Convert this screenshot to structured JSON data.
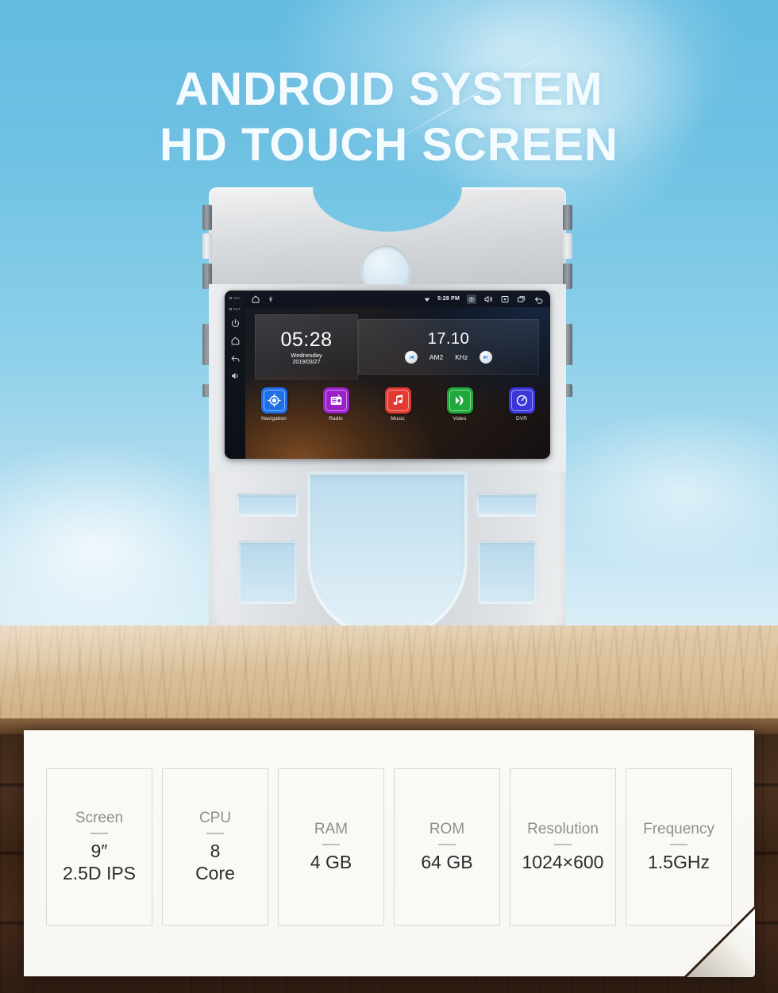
{
  "headline": {
    "line1": "ANDROID SYSTEM",
    "line2": "HD TOUCH SCREEN"
  },
  "colors": {
    "sky_top": "#63bbe1",
    "sky_bottom": "#dcf0f8",
    "headline_text": "#f4fbfe",
    "table_wood": "#dcc49f",
    "floor_wood": "#3b2415",
    "sheet_bg": "#faf9f6",
    "card_border": "#d8d8d4",
    "nav_icon": "#1f6fe8",
    "radio_icon": "#9b20c9",
    "music_icon": "#e23a32",
    "video_icon": "#1fa83c",
    "dvr_icon": "#3a36d8"
  },
  "device": {
    "side_buttons": [
      {
        "name": "mic-indicator",
        "label": "MIC",
        "type": "label"
      },
      {
        "name": "reset-indicator",
        "label": "RST",
        "type": "label"
      },
      {
        "name": "power-button",
        "label": "Power",
        "type": "icon"
      },
      {
        "name": "home-button",
        "label": "Home",
        "type": "icon"
      },
      {
        "name": "back-button",
        "label": "Back",
        "type": "icon"
      },
      {
        "name": "volume-button",
        "label": "Volume",
        "type": "icon"
      }
    ],
    "statusbar": {
      "home_icon": "home-icon",
      "assistant_icon": "assistant-icon",
      "wifi_icon": "wifi-icon",
      "time": "5:28 PM",
      "camera_icon": "camera-icon",
      "volume_icon": "speaker-icon",
      "close_icon": "close-box-icon",
      "recents_icon": "recents-icon",
      "back_icon": "back-arrow-icon"
    },
    "clock_widget": {
      "time": "05:28",
      "weekday": "Wednesday",
      "date": "2019/03/27"
    },
    "radio_widget": {
      "frequency": "17.10",
      "band": "AM2",
      "unit": "KHz",
      "prev_label": "Previous station",
      "next_label": "Next station"
    },
    "apps": [
      {
        "label": "Navigation",
        "icon": "navigation-target-icon",
        "color": "#1f6fe8"
      },
      {
        "label": "Radio",
        "icon": "radio-icon",
        "color": "#9b20c9"
      },
      {
        "label": "Music",
        "icon": "music-note-icon",
        "color": "#e23a32"
      },
      {
        "label": "Video",
        "icon": "video-play-icon",
        "color": "#1fa83c"
      },
      {
        "label": "DVR",
        "icon": "dvr-gauge-icon",
        "color": "#3a36d8"
      }
    ]
  },
  "specs": [
    {
      "title": "Screen",
      "value_line1": "9″",
      "value_line2": "2.5D IPS"
    },
    {
      "title": "CPU",
      "value_line1": "8",
      "value_line2": "Core"
    },
    {
      "title": "RAM",
      "value_line1": "4 GB",
      "value_line2": ""
    },
    {
      "title": "ROM",
      "value_line1": "64 GB",
      "value_line2": ""
    },
    {
      "title": "Resolution",
      "value_line1": "1024×600",
      "value_line2": ""
    },
    {
      "title": "Frequency",
      "value_line1": "1.5GHz",
      "value_line2": ""
    }
  ]
}
